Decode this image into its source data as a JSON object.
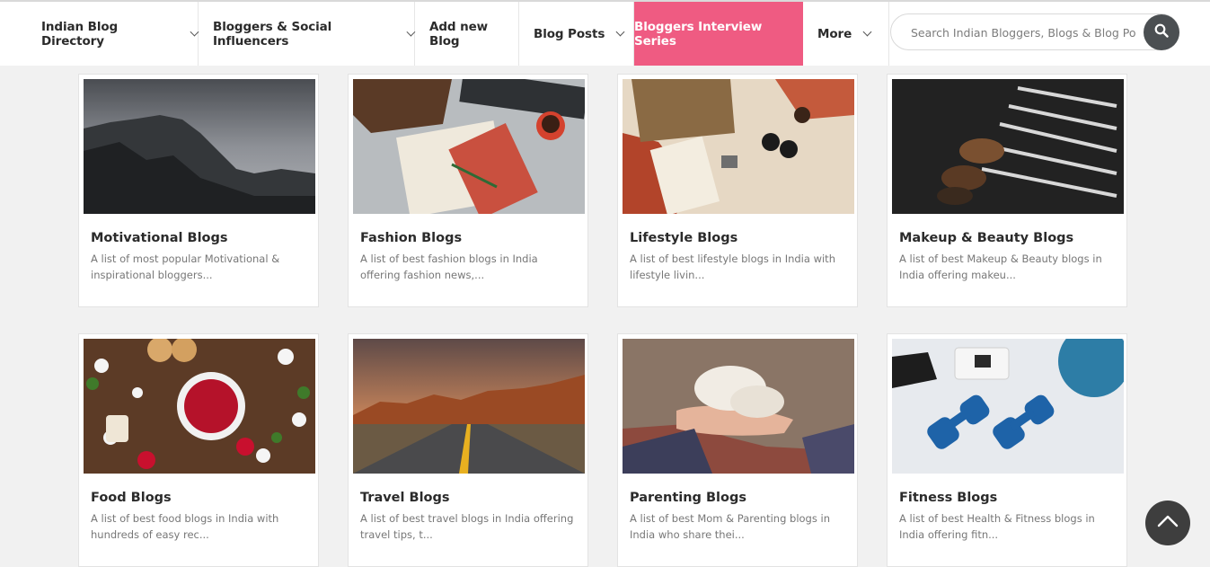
{
  "nav": {
    "items": [
      {
        "label": "Indian Blog Directory",
        "dropdown": true
      },
      {
        "label": "Bloggers & Social Influencers",
        "dropdown": true
      },
      {
        "label": "Add new Blog",
        "dropdown": false
      },
      {
        "label": "Blog Posts",
        "dropdown": true
      },
      {
        "label": "Bloggers Interview Series",
        "dropdown": false,
        "active": true
      },
      {
        "label": "More",
        "dropdown": true
      }
    ]
  },
  "search": {
    "placeholder": "Search Indian Bloggers, Blogs & Blog Posts.",
    "icon": "search-icon"
  },
  "cards": [
    {
      "title": "Motivational Blogs",
      "desc": "A list of most popular Motivational & inspirational bloggers...",
      "image": "mountain-cliff-image"
    },
    {
      "title": "Fashion Blogs",
      "desc": "A list of best fashion blogs in India offering fashion news,...",
      "image": "desk-notebook-image"
    },
    {
      "title": "Lifestyle Blogs",
      "desc": "A list of best lifestyle blogs in India with lifestyle livin...",
      "image": "travel-bag-image"
    },
    {
      "title": "Makeup & Beauty Blogs",
      "desc": "A list of best Makeup & Beauty blogs in India offering makeu...",
      "image": "makeup-brushes-image"
    },
    {
      "title": "Food Blogs",
      "desc": "A list of best food blogs in India with hundreds of easy rec...",
      "image": "raspberries-image"
    },
    {
      "title": "Travel Blogs",
      "desc": "A list of best travel blogs in India offering travel tips, t...",
      "image": "desert-road-image"
    },
    {
      "title": "Parenting Blogs",
      "desc": "A list of best Mom & Parenting blogs in India who share thei...",
      "image": "baby-shoes-image"
    },
    {
      "title": "Fitness Blogs",
      "desc": "A list of best Health & Fitness blogs in India offering fitn...",
      "image": "dumbbells-image"
    }
  ],
  "colors": {
    "accent": "#ef5b82",
    "dark": "#4b4f52",
    "background": "#f1f1f1"
  },
  "scroll_top_icon": "chevron-up-icon"
}
